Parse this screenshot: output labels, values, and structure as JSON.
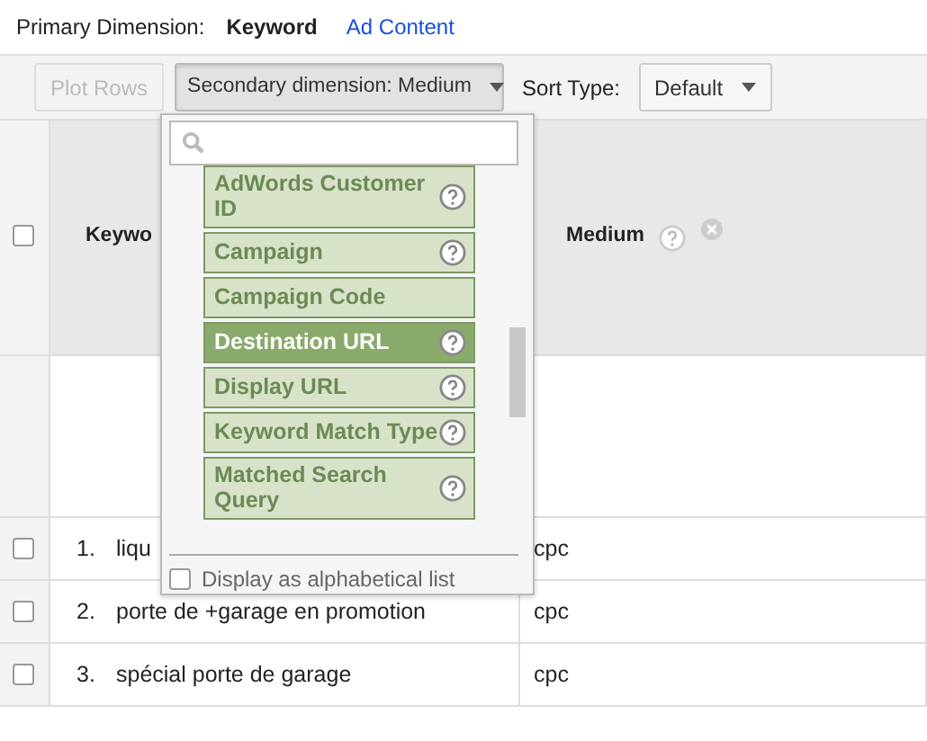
{
  "primary_dimension": {
    "label": "Primary Dimension:",
    "options": [
      {
        "label": "Keyword",
        "selected": true
      },
      {
        "label": "Ad Content",
        "selected": false
      }
    ]
  },
  "toolbar": {
    "plot_rows": {
      "label": "Plot Rows",
      "disabled": true
    },
    "secondary_dimension": {
      "label": "Secondary dimension: Medium",
      "expanded": true
    },
    "sort_type_label": "Sort Type:",
    "sort_type": {
      "label": "Default"
    }
  },
  "dropdown": {
    "items": [
      {
        "label": "AdWords Customer ID",
        "help": true,
        "selected": false
      },
      {
        "label": "Campaign",
        "help": true,
        "selected": false
      },
      {
        "label": "Campaign Code",
        "help": false,
        "selected": false
      },
      {
        "label": "Destination URL",
        "help": true,
        "selected": true
      },
      {
        "label": "Display URL",
        "help": true,
        "selected": false
      },
      {
        "label": "Keyword Match Type",
        "help": true,
        "selected": false
      },
      {
        "label": "Matched Search Query",
        "help": true,
        "selected": false
      }
    ],
    "alphabetical": {
      "label": "Display as alphabetical list",
      "checked": false
    }
  },
  "table": {
    "select_all": {
      "checked": false
    },
    "columns": [
      {
        "label": "Keywo"
      },
      {
        "label": "Medium",
        "help": true,
        "removable": true
      }
    ],
    "rows": [
      {
        "index": "1.",
        "keyword": "liqu",
        "medium": "cpc",
        "checked": false
      },
      {
        "index": "2.",
        "keyword": "porte de +garage en promotion",
        "medium": "cpc",
        "checked": false
      },
      {
        "index": "3.",
        "keyword": "spécial porte de garage",
        "medium": "cpc",
        "checked": false
      }
    ]
  }
}
